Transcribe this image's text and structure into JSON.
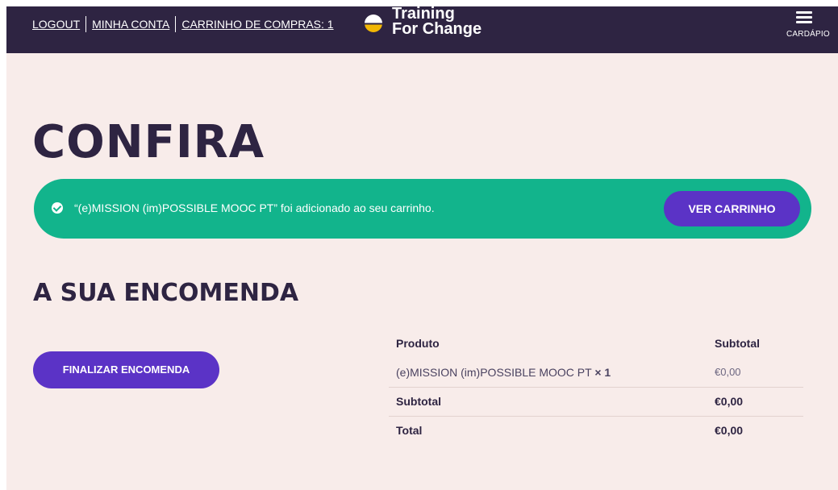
{
  "header": {
    "logout": "LOGOUT",
    "my_account": "MINHA CONTA",
    "cart": "CARRINHO DE COMPRAS: 1",
    "logo_line1": "Training",
    "logo_line2": "For Change",
    "menu_label": "CARDÁPIO"
  },
  "page": {
    "title": "CONFIRA"
  },
  "notice": {
    "message": "“(e)MISSION (im)POSSIBLE MOOC PT” foi adicionado ao seu carrinho.",
    "view_cart": "VER CARRINHO"
  },
  "order": {
    "heading": "A SUA ENCOMENDA",
    "checkout_button": "FINALIZAR ENCOMENDA",
    "col_product": "Produto",
    "col_subtotal": "Subtotal",
    "item_name": "(e)MISSION (im)POSSIBLE MOOC PT",
    "item_qty": "× 1",
    "item_price": "€0,00",
    "subtotal_label": "Subtotal",
    "subtotal_value": "€0,00",
    "total_label": "Total",
    "total_value": "€0,00"
  },
  "colors": {
    "header_bg": "#2e2442",
    "page_bg": "#f8ecea",
    "notice_bg": "#12b48c",
    "button_bg": "#5b33c6",
    "logo_accent": "#f2b705"
  }
}
